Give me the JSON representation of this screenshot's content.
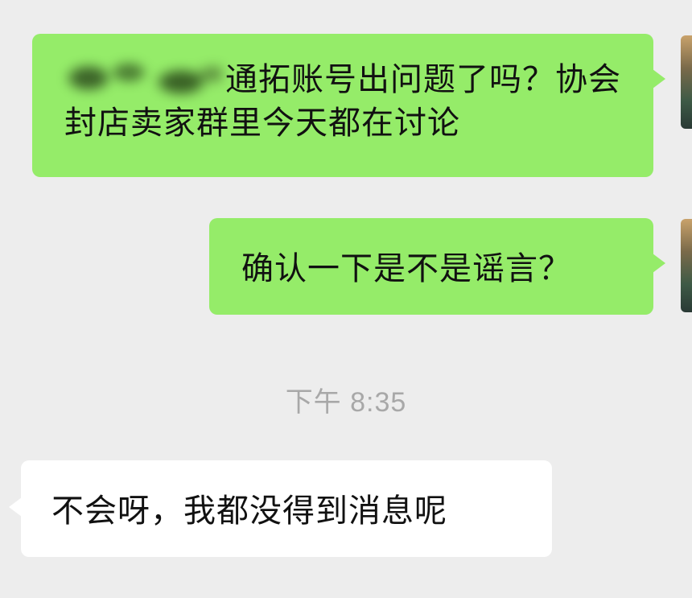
{
  "messages": [
    {
      "direction": "outgoing",
      "text": "通拓账号出问题了吗？协会封店卖家群里今天都在讨论",
      "redacted_prefix": true
    },
    {
      "direction": "outgoing",
      "text": "确认一下是不是谣言？"
    },
    {
      "direction": "incoming",
      "text": "不会呀，我都没得到消息呢"
    }
  ],
  "timestamp": "下午 8:35",
  "colors": {
    "background": "#ededed",
    "outgoing_bubble": "#95ec69",
    "incoming_bubble": "#ffffff",
    "timestamp_text": "#a8a8a8"
  },
  "icons": {
    "avatar": "user-avatar-image",
    "redaction": "blurred-name"
  }
}
